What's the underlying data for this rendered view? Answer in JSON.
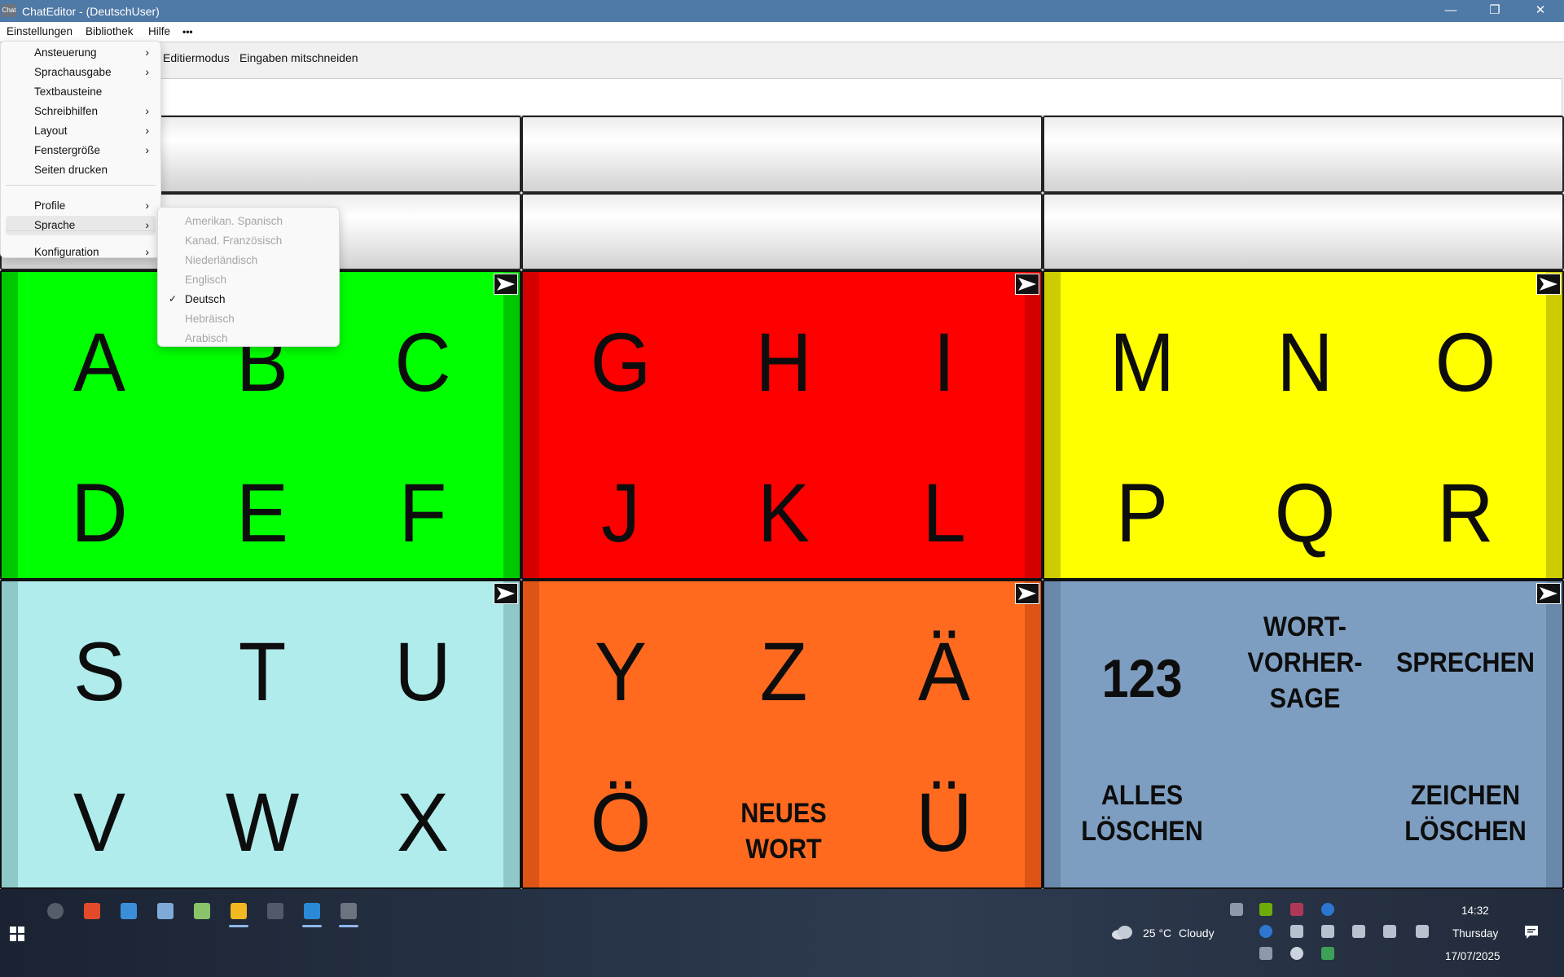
{
  "window": {
    "title": "ChatEditor - (DeutschUser)",
    "app_icon_text": "Chat",
    "minimize": "—",
    "maximize": "❐",
    "close": "✕"
  },
  "menubar": {
    "items": [
      "Einstellungen",
      "Bibliothek",
      "Hilfe",
      "•••"
    ]
  },
  "toolbar": {
    "items": [
      "Editiermodus",
      "Eingaben mitschneiden"
    ]
  },
  "einstellungen_menu": {
    "items": [
      {
        "label": "Ansteuerung",
        "chevron": "›"
      },
      {
        "label": "Sprachausgabe",
        "chevron": "›"
      },
      {
        "label": "Textbausteine",
        "chevron": ""
      },
      {
        "label": "Schreibhilfen",
        "chevron": "›"
      },
      {
        "label": "Layout",
        "chevron": "›"
      },
      {
        "label": "Fenstergröße",
        "chevron": "›"
      },
      {
        "label": "Seiten drucken",
        "chevron": ""
      },
      {
        "label": "Profile",
        "chevron": "›"
      },
      {
        "label": "Sprache",
        "chevron": "›"
      },
      {
        "label": "Konfiguration",
        "chevron": "›"
      }
    ]
  },
  "sprache_menu": {
    "items": [
      {
        "label": "Amerikan. Spanisch",
        "enabled": false,
        "checked": false
      },
      {
        "label": "Kanad. Französisch",
        "enabled": false,
        "checked": false
      },
      {
        "label": "Niederländisch",
        "enabled": false,
        "checked": false
      },
      {
        "label": "Englisch",
        "enabled": false,
        "checked": false
      },
      {
        "label": "Deutsch",
        "enabled": true,
        "checked": true
      },
      {
        "label": "Hebräisch",
        "enabled": false,
        "checked": false
      },
      {
        "label": "Arabisch",
        "enabled": false,
        "checked": false
      }
    ],
    "check_mark": "✓"
  },
  "tiles": [
    {
      "color": "#00ff00",
      "edge": "#00c800",
      "cells": [
        "A",
        "B",
        "C",
        "D",
        "E",
        "F"
      ]
    },
    {
      "color": "#ff0000",
      "edge": "#d40000",
      "cells": [
        "G",
        "H",
        "I",
        "J",
        "K",
        "L"
      ]
    },
    {
      "color": "#ffff00",
      "edge": "#cccc00",
      "cells": [
        "M",
        "N",
        "O",
        "P",
        "Q",
        "R"
      ]
    },
    {
      "color": "#b0ecec",
      "edge": "#8fc8c8",
      "cells": [
        "S",
        "T",
        "U",
        "V",
        "W",
        "X"
      ]
    },
    {
      "color": "#ff6a1f",
      "edge": "#dd5416",
      "cells": [
        "Y",
        "Z",
        "Ä",
        "Ö",
        "NEUES WORT",
        "Ü"
      ]
    },
    {
      "color": "#7e9ec1",
      "edge": "#6a88aa",
      "cells": [
        "123",
        "WORT-\nVORHER-\nSAGE",
        "SPRECHEN",
        "ALLES\nLÖSCHEN",
        "",
        "ZEICHEN\nLÖSCHEN"
      ]
    }
  ],
  "taskbar": {
    "weather": {
      "temp": "25 °C",
      "condition": "Cloudy"
    },
    "clock": {
      "time": "14:32",
      "day": "Thursday",
      "date": "17/07/2025"
    },
    "pinned_icons": [
      "settings-icon",
      "brave-browser-icon",
      "remote-desktop-icon",
      "photos-icon",
      "notepad-icon",
      "file-explorer-icon",
      "terminal-icon",
      "vscode-icon",
      "chateditor-icon"
    ],
    "tray_icons": [
      "vpn-icon",
      "nvidia-icon",
      "audio-device-icon",
      "bluetooth-icon",
      "r-app-icon",
      "volume-icon",
      "battery-icon",
      "pen-icon",
      "keyboard-icon",
      "gear-icon",
      "network-icon",
      "headset-icon",
      "h-app-icon"
    ]
  }
}
